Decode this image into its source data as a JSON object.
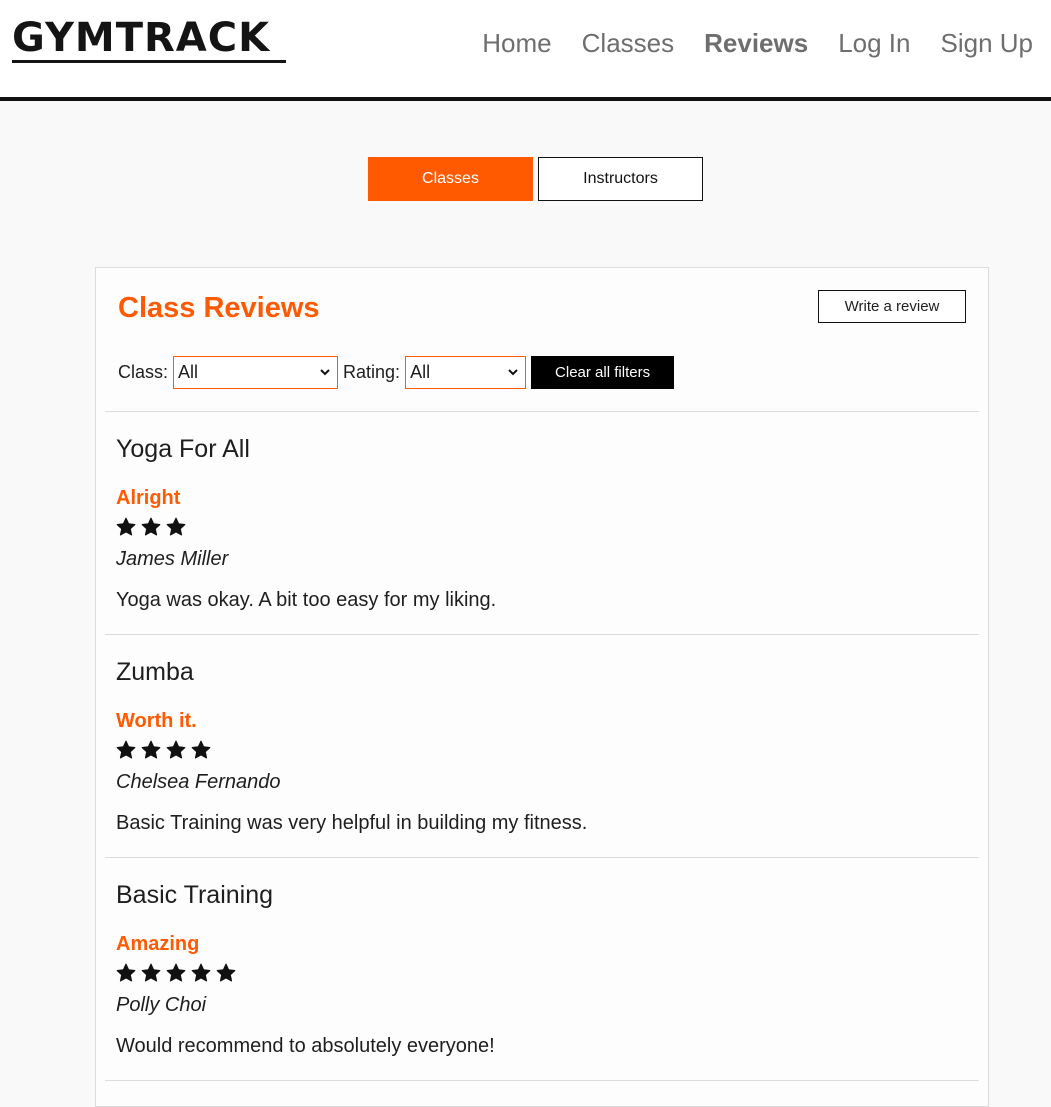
{
  "header": {
    "logo": "GYMTRACK",
    "nav": [
      {
        "label": "Home",
        "active": false
      },
      {
        "label": "Classes",
        "active": false
      },
      {
        "label": "Reviews",
        "active": true
      },
      {
        "label": "Log In",
        "active": false
      },
      {
        "label": "Sign Up",
        "active": false
      }
    ]
  },
  "toggle": {
    "classes_label": "Classes",
    "instructors_label": "Instructors",
    "selected": "Classes"
  },
  "reviews_panel": {
    "title": "Class Reviews",
    "write_review_label": "Write a review",
    "filters": {
      "class_label": "Class:",
      "class_value": "All",
      "rating_label": "Rating:",
      "rating_value": "All",
      "clear_label": "Clear all filters"
    },
    "reviews": [
      {
        "class_name": "Yoga For All",
        "title": "Alright",
        "rating": 3,
        "author": "James Miller",
        "text": "Yoga was okay. A bit too easy for my liking."
      },
      {
        "class_name": "Zumba",
        "title": "Worth it.",
        "rating": 4,
        "author": "Chelsea Fernando",
        "text": "Basic Training was very helpful in building my fitness."
      },
      {
        "class_name": "Basic Training",
        "title": "Amazing",
        "rating": 5,
        "author": "Polly Choi",
        "text": "Would recommend to absolutely everyone!"
      }
    ]
  },
  "colors": {
    "accent": "#ff5a00",
    "text": "#1e1e1e",
    "nav_text": "#6e6e6e",
    "star": "#111111"
  },
  "icons": {
    "star": "star-icon",
    "dropdown": "chevron-down-icon"
  }
}
